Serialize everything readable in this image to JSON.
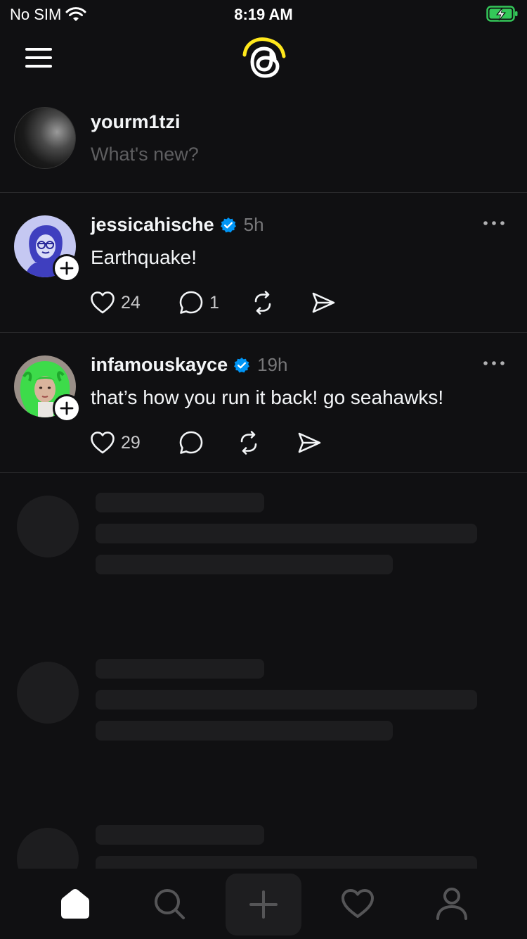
{
  "status_bar": {
    "carrier": "No SIM",
    "time": "8:19 AM",
    "battery_color": "#34c759"
  },
  "topbar": {
    "menu_icon": "hamburger-menu-icon",
    "logo_icon": "threads-logo-icon",
    "logo_accent": "#ffe81c"
  },
  "composer": {
    "username": "yourm1tzi",
    "placeholder": "What's new?"
  },
  "posts": [
    {
      "handle": "jessicahische",
      "verified": true,
      "age": "5h",
      "text": "Earthquake!",
      "likes": "24",
      "replies": "1"
    },
    {
      "handle": "infamouskayce",
      "verified": true,
      "age": "19h",
      "text": "that’s how you run it back! go seahawks!",
      "likes": "29",
      "replies": ""
    }
  ],
  "colors": {
    "background": "#101012",
    "verified": "#0095f6",
    "muted": "#777779",
    "skeleton": "#1d1d1f"
  },
  "tabbar": {
    "items": [
      "home-icon",
      "search-icon",
      "compose-icon",
      "activity-heart-icon",
      "profile-icon"
    ]
  }
}
